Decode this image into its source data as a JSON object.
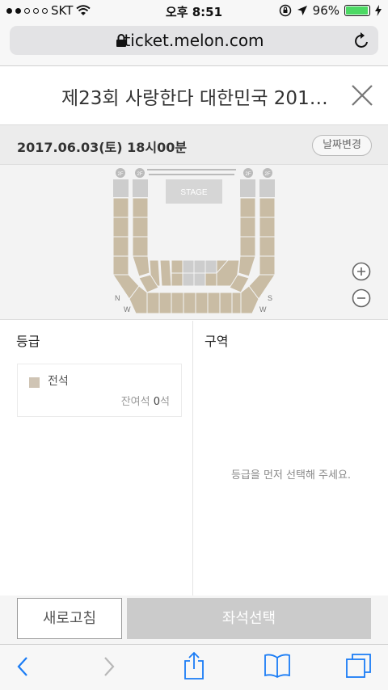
{
  "status": {
    "carrier": "SKT",
    "time": "오후 8:51",
    "battery": "96%",
    "battery_level": 0.96
  },
  "browser": {
    "url": "ticket.melon.com"
  },
  "header": {
    "title": "제23회 사랑한다 대한민국 201…"
  },
  "datebar": {
    "date": "2017.06.03(토) 18시00분",
    "change_label": "날짜변경"
  },
  "seatmap": {
    "stage_label": "STAGE",
    "floor_label": "2F",
    "compass": [
      "N",
      "W",
      "S",
      "W"
    ]
  },
  "grade_panel": {
    "title": "등급",
    "grade_name": "전석",
    "remaining_label": "잔여석",
    "remaining_count": "0",
    "remaining_unit": "석"
  },
  "area_panel": {
    "title": "구역",
    "message": "등급을 먼저 선택해 주세요."
  },
  "buttons": {
    "refresh": "새로고침",
    "select_seat": "좌석선택"
  },
  "colors": {
    "seat_block": "#c9bca4",
    "seat_block_dark": "#b7a98e",
    "seat_disabled": "#cdcdcd",
    "accent_green": "#4cd964"
  }
}
